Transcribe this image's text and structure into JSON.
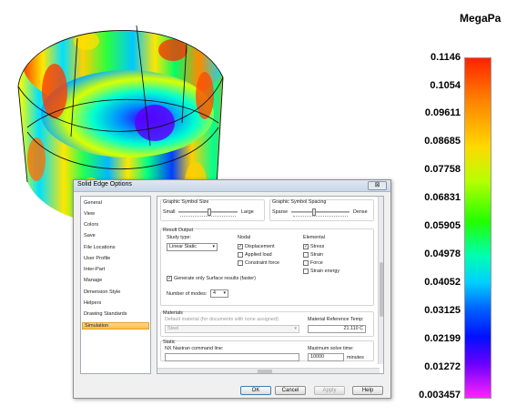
{
  "legend": {
    "unit": "MegaPa",
    "ticks": [
      "0.1146",
      "0.1054",
      "0.09611",
      "0.08685",
      "0.07758",
      "0.06831",
      "0.05905",
      "0.04978",
      "0.04052",
      "0.03125",
      "0.02199",
      "0.01272",
      "0.003457"
    ]
  },
  "dialog": {
    "title": "Solid Edge Options",
    "close_glyph": "⊠",
    "nav_items": [
      "General",
      "View",
      "Colors",
      "Save",
      "File Locations",
      "User Profile",
      "Inter-Part",
      "Manage",
      "Dimension Style",
      "Helpers",
      "Drawing Standards",
      "Simulation"
    ],
    "selected_nav": "Simulation",
    "symbol_size": {
      "label": "Graphic Symbol Size",
      "min_label": "Small",
      "max_label": "Large"
    },
    "symbol_spacing": {
      "label": "Graphic Symbol Spacing",
      "min_label": "Sparse",
      "max_label": "Dense"
    },
    "result_output": {
      "label": "Result Output",
      "study_type_label": "Study type:",
      "study_type_value": "Linear Static",
      "nodal_label": "Nodal",
      "nodal_items": [
        {
          "label": "Displacement",
          "checked": true
        },
        {
          "label": "Applied load",
          "checked": false
        },
        {
          "label": "Constraint force",
          "checked": false
        }
      ],
      "elemental_label": "Elemental",
      "elemental_items": [
        {
          "label": "Stress",
          "checked": true
        },
        {
          "label": "Strain",
          "checked": false
        },
        {
          "label": "Force",
          "checked": false
        },
        {
          "label": "Strain energy",
          "checked": false
        }
      ],
      "surface_only_label": "Generate only Surface results (faster)",
      "surface_only_checked": true,
      "modes_label": "Number of modes:",
      "modes_value": "4"
    },
    "materials": {
      "label": "Materials",
      "default_material_label": "Default material (for documents with none assigned):",
      "default_material_value": "Steel",
      "ref_temp_label": "Material Reference Temp:",
      "ref_temp_value": "21.110 C"
    },
    "static": {
      "label": "Static",
      "nastran_label": "NX Nastran command line:",
      "nastran_value": "",
      "max_time_label": "Maximum solve time:",
      "max_time_value": "10000",
      "max_time_unit": "minutes"
    },
    "check_glyph": "✓",
    "combo_arrow": "▾",
    "buttons": {
      "ok": "OK",
      "cancel": "Cancel",
      "apply": "Apply",
      "help": "Help"
    }
  }
}
